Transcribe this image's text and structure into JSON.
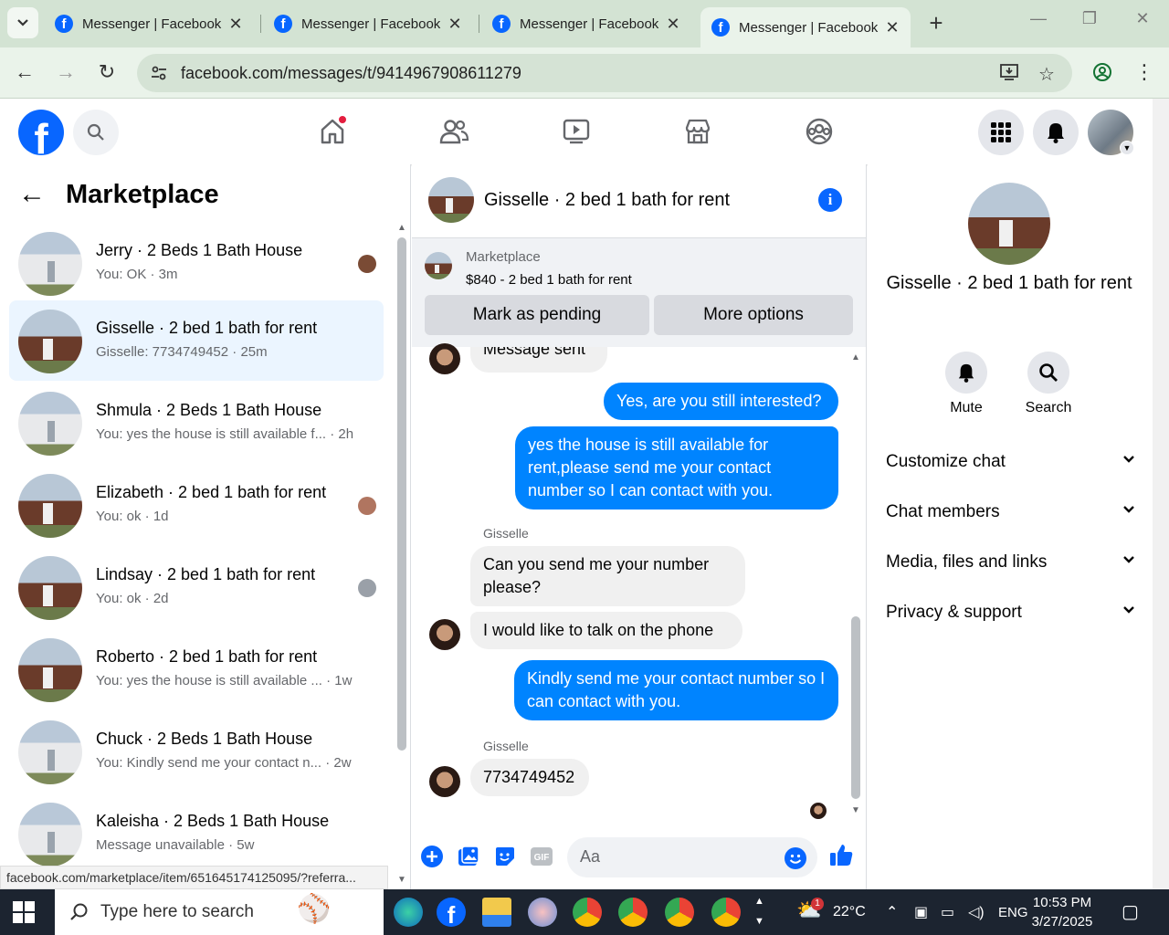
{
  "browser": {
    "tabs": [
      {
        "title": "Messenger | Facebook"
      },
      {
        "title": "Messenger | Facebook"
      },
      {
        "title": "Messenger | Facebook"
      },
      {
        "title": "Messenger | Facebook"
      }
    ],
    "url": "facebook.com/messages/t/9414967908611279"
  },
  "left": {
    "title": "Marketplace",
    "conversations": [
      {
        "name": "Jerry · 2 Beds 1 Bath House",
        "snippet": "You: OK · 3m",
        "thumb": "white"
      },
      {
        "name": "Gisselle · 2 bed 1 bath for rent",
        "snippet": "Gisselle: 7734749452 · 25m",
        "thumb": "brick"
      },
      {
        "name": "Shmula · 2 Beds 1 Bath House",
        "snippet": "You: yes the house is still available f... · 2h",
        "thumb": "white"
      },
      {
        "name": "Elizabeth · 2 bed 1 bath for rent",
        "snippet": "You: ok · 1d",
        "thumb": "brick"
      },
      {
        "name": "Lindsay · 2 bed 1 bath for rent",
        "snippet": "You: ok · 2d",
        "thumb": "brick"
      },
      {
        "name": "Roberto · 2 bed 1 bath for rent",
        "snippet": "You: yes the house is still available ... · 1w",
        "thumb": "brick"
      },
      {
        "name": "Chuck · 2 Beds 1 Bath House",
        "snippet": "You: Kindly send me your contact n... · 2w",
        "thumb": "white"
      },
      {
        "name": "Kaleisha · 2 Beds 1 Bath House",
        "snippet": "Message unavailable · 5w",
        "thumb": "white"
      }
    ],
    "status_url": "facebook.com/marketplace/item/651645174125095/?referra..."
  },
  "chat": {
    "title": "Gisselle · 2 bed 1 bath for rent",
    "marketplace_label": "Marketplace",
    "listing": "$840 - 2 bed 1 bath for rent",
    "mark_pending": "Mark as pending",
    "more_options": "More options",
    "messages": {
      "m0": "Message sent",
      "m1": "Yes, are you still interested?",
      "m2": "yes the house is still available for rent,please send me your contact number so I can contact with you.",
      "sender1": "Gisselle",
      "m3": "Can you send me your number please?",
      "m4": "I would like to talk on the phone",
      "m5": "Kindly send me your contact number so I can contact with you.",
      "sender2": "Gisselle",
      "m6": "7734749452"
    },
    "composer_placeholder": "Aa"
  },
  "right": {
    "name": "Gisselle · 2 bed 1 bath for rent",
    "mute": "Mute",
    "search": "Search",
    "sections": [
      "Customize chat",
      "Chat members",
      "Media, files and links",
      "Privacy & support"
    ]
  },
  "taskbar": {
    "search_placeholder": "Type here to search",
    "weather": "22°C",
    "weather_badge": "1",
    "lang": "ENG",
    "time": "10:53 PM",
    "date": "3/27/2025"
  },
  "colors": {
    "fb_blue": "#0866ff",
    "bubble_out": "#0084ff",
    "active_conv": "#ebf5ff"
  }
}
